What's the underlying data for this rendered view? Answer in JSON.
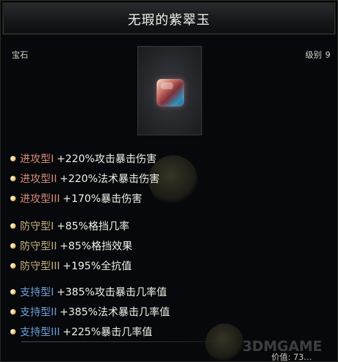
{
  "item": {
    "title": "无瑕的紫翠玉",
    "type": "宝石",
    "level_label": "级别",
    "level_value": "9",
    "icon": "gem-icon",
    "gem_colors": [
      "#f6d6c8",
      "#c0665a",
      "#7d2f3a",
      "#2f8fb8"
    ]
  },
  "sections": {
    "attack": [
      {
        "category": "进攻型I",
        "effect": "+220%攻击暴击伤害"
      },
      {
        "category": "进攻型II",
        "effect": "+220%法术暴击伤害"
      },
      {
        "category": "进攻型III",
        "effect": "+170%暴击伤害"
      }
    ],
    "defense": [
      {
        "category": "防守型I",
        "effect": "+85%格挡几率"
      },
      {
        "category": "防守型II",
        "effect": "+85%格挡效果"
      },
      {
        "category": "防守型III",
        "effect": "+195%全抗值"
      }
    ],
    "support": [
      {
        "category": "支持型I",
        "effect": "+385%攻击暴击几率值"
      },
      {
        "category": "支持型II",
        "effect": "+385%法术暴击几率值"
      },
      {
        "category": "支持型III",
        "effect": "+225%暴击几率值"
      }
    ]
  },
  "price": "价值: 73…",
  "watermark": "3DMGAME",
  "colors": {
    "attack": "#d98a74",
    "defense": "#c7b07a",
    "support": "#6f9fd8",
    "bullet": "#e8c77a"
  }
}
